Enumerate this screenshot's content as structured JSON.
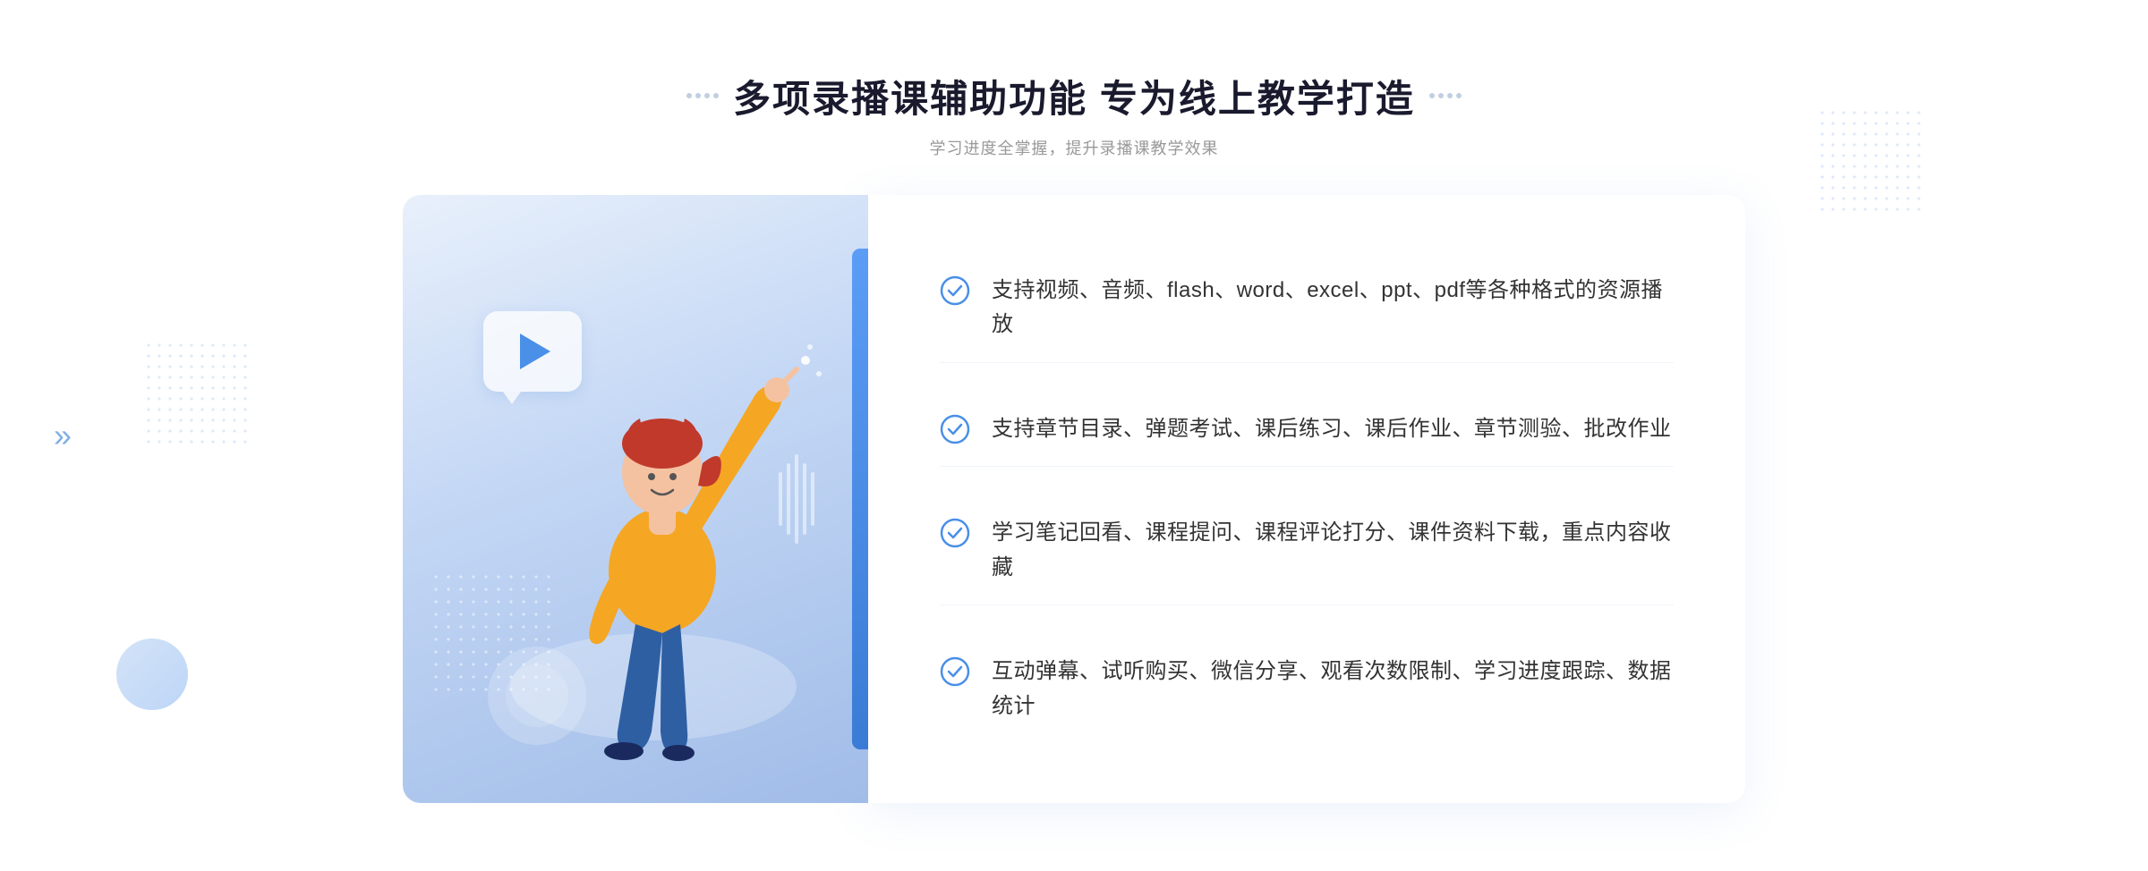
{
  "header": {
    "title": "多项录播课辅助功能 专为线上教学打造",
    "subtitle": "学习进度全掌握，提升录播课教学效果",
    "dots_left": "decorative-dots",
    "dots_right": "decorative-dots"
  },
  "features": [
    {
      "id": 1,
      "text": "支持视频、音频、flash、word、excel、ppt、pdf等各种格式的资源播放"
    },
    {
      "id": 2,
      "text": "支持章节目录、弹题考试、课后练习、课后作业、章节测验、批改作业"
    },
    {
      "id": 3,
      "text": "学习笔记回看、课程提问、课程评论打分、课件资料下载，重点内容收藏"
    },
    {
      "id": 4,
      "text": "互动弹幕、试听购买、微信分享、观看次数限制、学习进度跟踪、数据统计"
    }
  ],
  "colors": {
    "primary": "#4a8fe8",
    "check_circle": "#4a8fe8",
    "title_color": "#1a1a2e",
    "text_color": "#333333",
    "subtitle_color": "#999999"
  }
}
